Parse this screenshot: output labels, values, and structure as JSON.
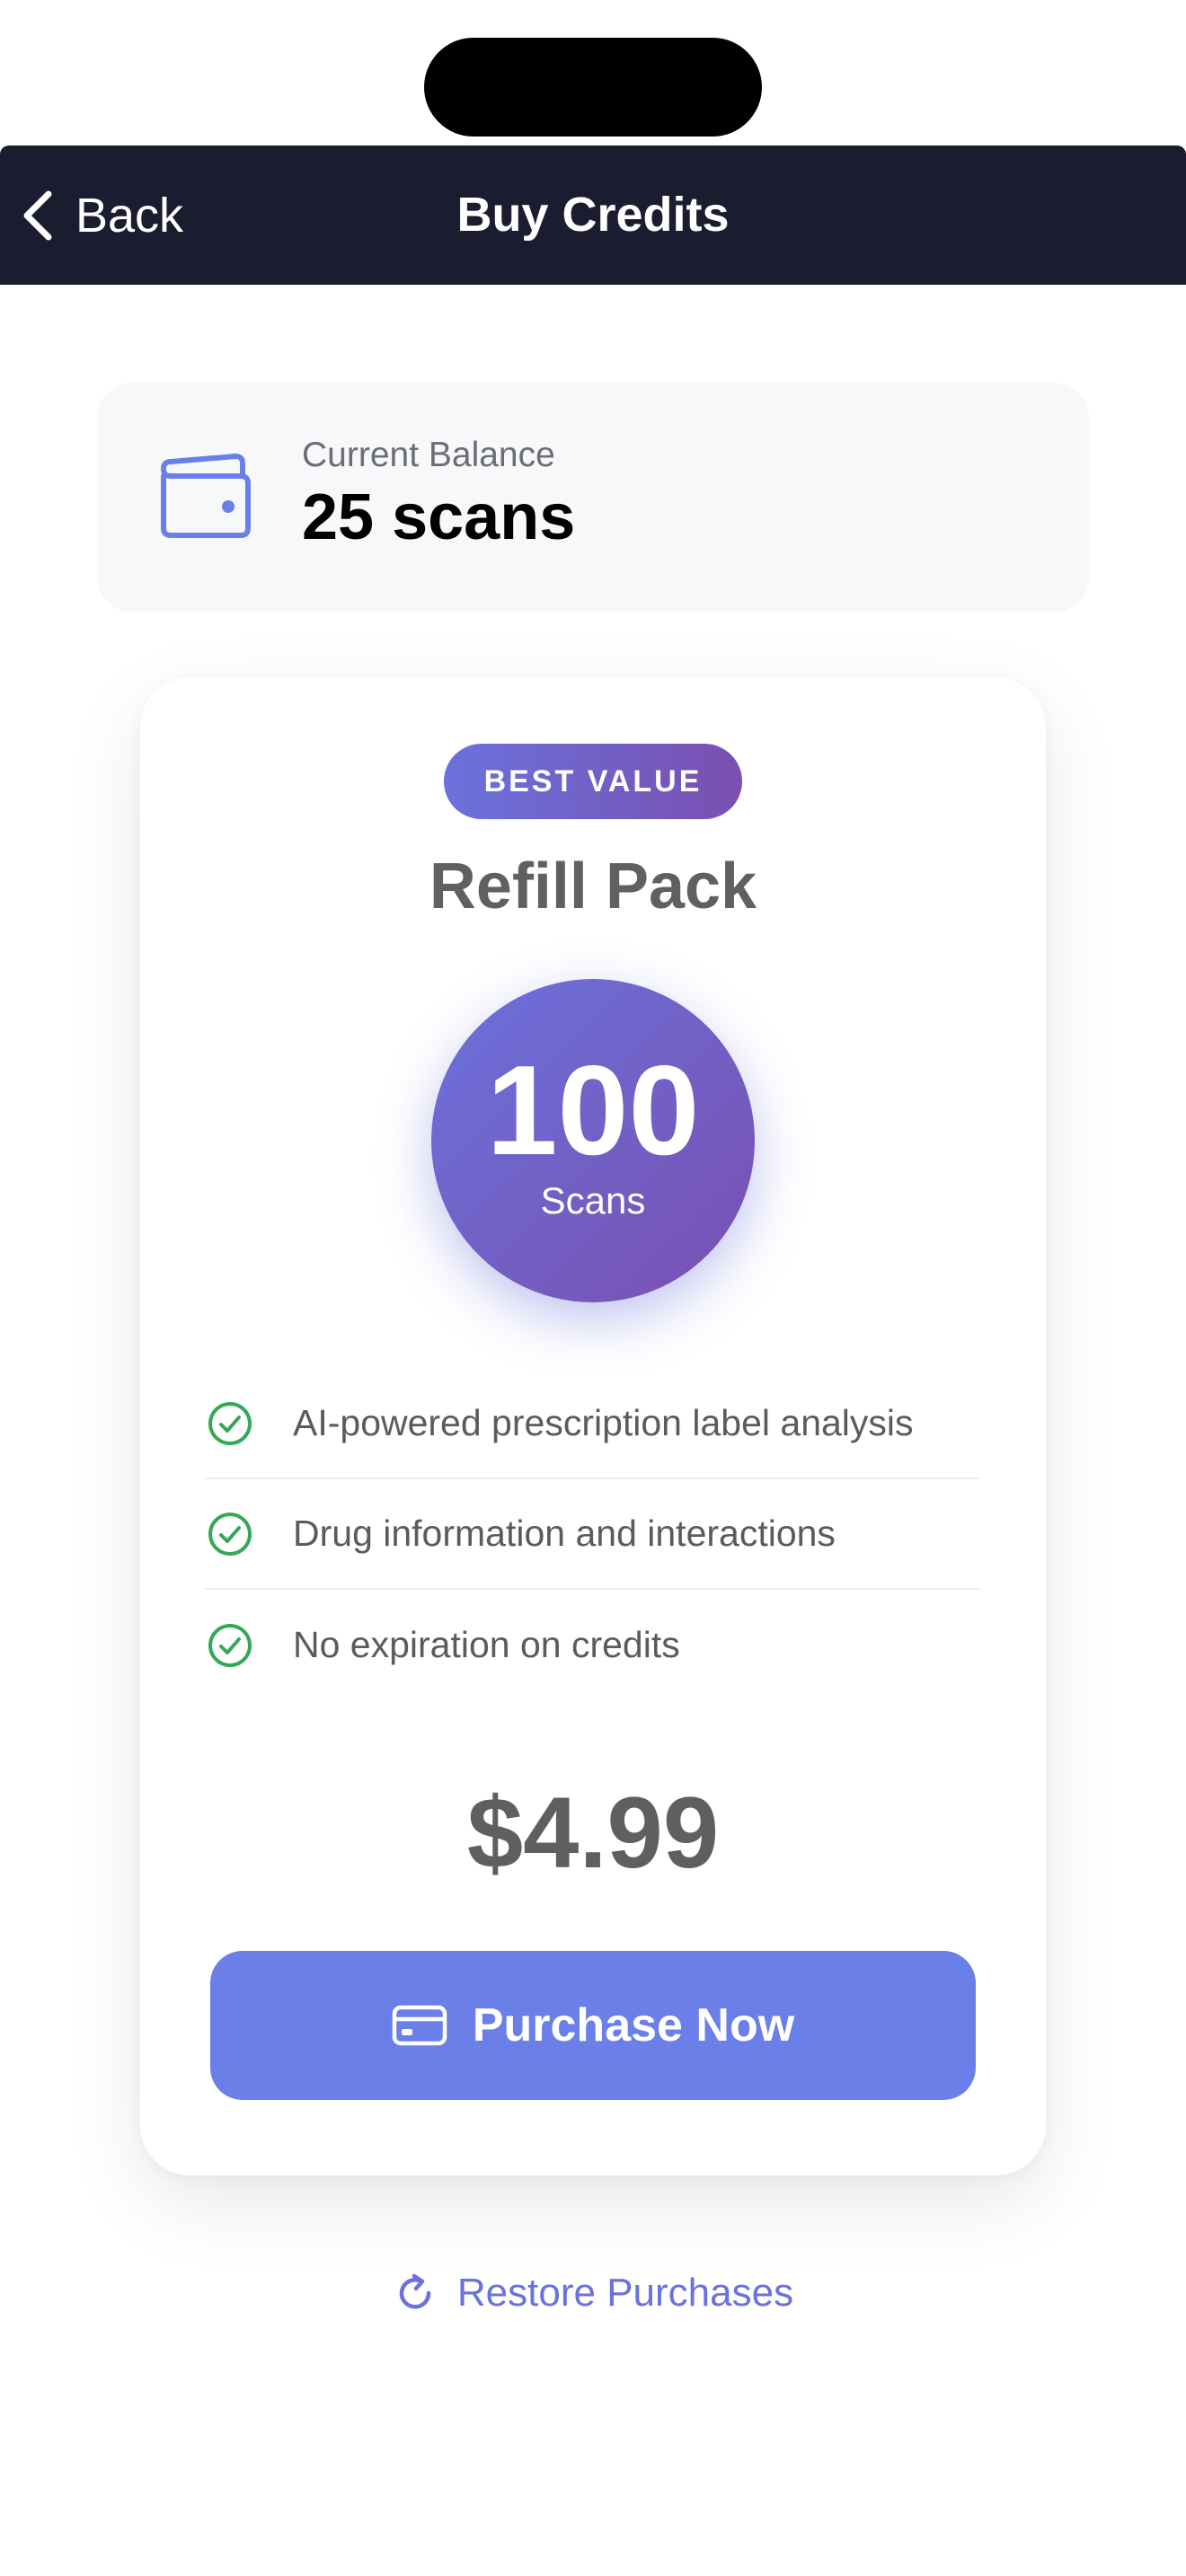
{
  "nav": {
    "back_label": "Back",
    "title": "Buy Credits"
  },
  "balance": {
    "label": "Current Balance",
    "value": "25 scans",
    "icon": "wallet-icon"
  },
  "pack": {
    "badge": "BEST VALUE",
    "title": "Refill Pack",
    "scan_count": "100",
    "scan_unit": "Scans",
    "features": [
      {
        "label": "AI-powered prescription label analysis",
        "icon": "check-circle-icon"
      },
      {
        "label": "Drug information and interactions",
        "icon": "check-circle-icon"
      },
      {
        "label": "No expiration on credits",
        "icon": "check-circle-icon"
      }
    ],
    "price": "$4.99",
    "purchase_label": "Purchase Now",
    "purchase_icon": "credit-card-icon"
  },
  "restore": {
    "label": "Restore Purchases",
    "icon": "refresh-icon"
  },
  "colors": {
    "nav_background": "#1b1c30",
    "accent": "#6a72dc",
    "gradient_end": "#7a4fb0",
    "button": "#6a7fe8",
    "check": "#34a853"
  }
}
